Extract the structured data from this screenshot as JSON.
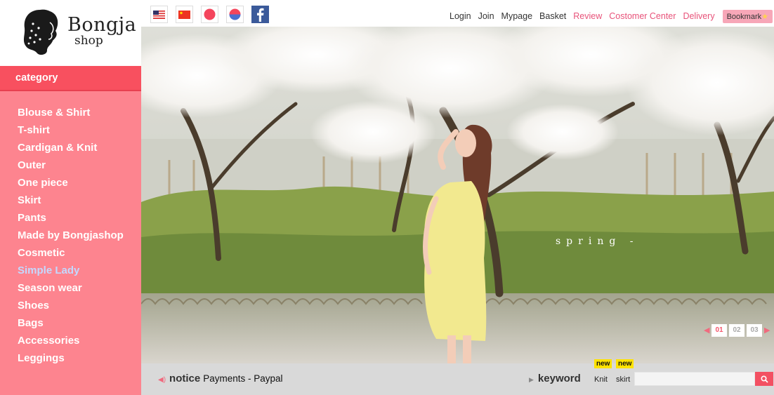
{
  "logo": {
    "title": "Bongja",
    "subtitle": "shop"
  },
  "flags": [
    "us-flag-icon",
    "china-flag-icon",
    "japan-flag-icon",
    "korea-flag-icon",
    "facebook-icon"
  ],
  "topnav": {
    "login": "Login",
    "join": "Join",
    "mypage": "Mypage",
    "basket": "Basket",
    "review": "Review",
    "customer_center": "Costomer Center",
    "delivery": "Delivery",
    "bookmark": "Bookmark"
  },
  "sidebar": {
    "heading": "category",
    "items": [
      {
        "label": "Blouse & Shirt"
      },
      {
        "label": "T-shirt"
      },
      {
        "label": "Cardigan & Knit"
      },
      {
        "label": "Outer"
      },
      {
        "label": "One piece"
      },
      {
        "label": "Skirt"
      },
      {
        "label": "Pants"
      },
      {
        "label": "Made by Bongjashop"
      },
      {
        "label": "Cosmetic"
      },
      {
        "label": "Simple Lady",
        "active": true
      },
      {
        "label": "Season wear"
      },
      {
        "label": "Shoes"
      },
      {
        "label": "Bags"
      },
      {
        "label": "Accessories"
      },
      {
        "label": "Leggings"
      }
    ]
  },
  "banner": {
    "caption": "spring -",
    "pages": [
      "01",
      "02",
      "03"
    ],
    "current_page": "01"
  },
  "notice": {
    "label": "notice",
    "text": "Payments - Paypal"
  },
  "keyword": {
    "label": "keyword",
    "tags": [
      {
        "badge": "new",
        "word": "Knit"
      },
      {
        "badge": "new",
        "word": "skirt"
      }
    ],
    "search_value": ""
  },
  "colors": {
    "sidebar": "#fd848f",
    "category_header": "#f8505f",
    "accent_pink": "#e8537a",
    "active_item": "#c4d8ff",
    "badge_yellow": "#ffe300"
  }
}
